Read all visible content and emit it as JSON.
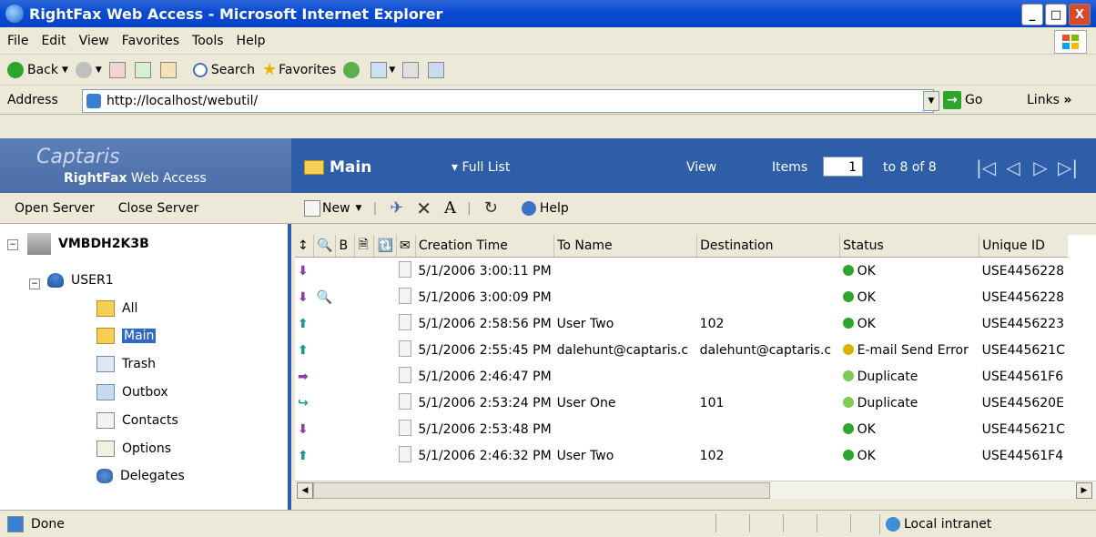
{
  "window": {
    "title": "RightFax Web Access - Microsoft Internet Explorer",
    "btn_min": "_",
    "btn_max": "□",
    "btn_close": "X"
  },
  "menu": [
    "File",
    "Edit",
    "View",
    "Favorites",
    "Tools",
    "Help"
  ],
  "toolbar": {
    "back": "Back",
    "search": "Search",
    "favorites": "Favorites"
  },
  "address": {
    "label": "Address",
    "url": "http://localhost/webutil/",
    "go": "Go",
    "links": "Links",
    "links_chevron": "»"
  },
  "app": {
    "brand": "Captaris",
    "product_bold": "RightFax",
    "product_rest": " Web Access",
    "folder_title": "Main",
    "full_list": "▾ Full List",
    "view": "View",
    "items_label": "Items",
    "page": "1",
    "range": "to 8 of 8",
    "nav": [
      "|◁",
      "◁",
      "▷",
      "▷|"
    ]
  },
  "left_toolbar": {
    "open": "Open Server",
    "close": "Close Server"
  },
  "tree": {
    "server": "VMBDH2K3B",
    "user": "USER1",
    "folders": [
      "All",
      "Main",
      "Trash",
      "Outbox",
      "Contacts",
      "Options",
      "Delegates"
    ],
    "selected": "Main"
  },
  "grid_toolbar": {
    "new": "New",
    "help": "Help"
  },
  "grid": {
    "headers": [
      "Creation Time",
      "To Name",
      "Destination",
      "Status",
      "Unique ID"
    ],
    "header_icons": [
      "↕",
      "🔍",
      "B",
      "🗎",
      "🔃",
      "✉"
    ],
    "rows": [
      {
        "dir": "down",
        "dir_color": "#8a3fa8",
        "extra": "",
        "time": "5/1/2006 3:00:11 PM",
        "to": "",
        "dest": "",
        "status": "OK",
        "status_color": "#2ea52e",
        "uid": "USE4456228"
      },
      {
        "dir": "down",
        "dir_color": "#8a3fa8",
        "extra": "🔍",
        "time": "5/1/2006 3:00:09 PM",
        "to": "",
        "dest": "",
        "status": "OK",
        "status_color": "#2ea52e",
        "uid": "USE4456228"
      },
      {
        "dir": "up",
        "dir_color": "#1f9a8a",
        "extra": "",
        "time": "5/1/2006 2:58:56 PM",
        "to": "User Two",
        "dest": "102",
        "status": "OK",
        "status_color": "#2ea52e",
        "uid": "USE4456223"
      },
      {
        "dir": "up",
        "dir_color": "#1f9a8a",
        "extra": "",
        "time": "5/1/2006 2:55:45 PM",
        "to": "dalehunt@captaris.c",
        "dest": "dalehunt@captaris.c",
        "status": "E-mail Send Error",
        "status_color": "#d8b400",
        "uid": "USE445621C"
      },
      {
        "dir": "fwd",
        "dir_color": "#8a3fa8",
        "extra": "",
        "time": "5/1/2006 2:46:47 PM",
        "to": "",
        "dest": "",
        "status": "Duplicate",
        "status_color": "#7fcc55",
        "uid": "USE44561F6"
      },
      {
        "dir": "curve",
        "dir_color": "#1f9a8a",
        "extra": "",
        "time": "5/1/2006 2:53:24 PM",
        "to": "User One",
        "dest": "101",
        "status": "Duplicate",
        "status_color": "#7fcc55",
        "uid": "USE445620E"
      },
      {
        "dir": "down",
        "dir_color": "#8a3fa8",
        "extra": "",
        "time": "5/1/2006 2:53:48 PM",
        "to": "",
        "dest": "",
        "status": "OK",
        "status_color": "#2ea52e",
        "uid": "USE445621C"
      },
      {
        "dir": "up",
        "dir_color": "#1f9a8a",
        "extra": "",
        "time": "5/1/2006 2:46:32 PM",
        "to": "User Two",
        "dest": "102",
        "status": "OK",
        "status_color": "#2ea52e",
        "uid": "USE44561F4"
      }
    ]
  },
  "status": {
    "text": "Done",
    "zone": "Local intranet"
  }
}
